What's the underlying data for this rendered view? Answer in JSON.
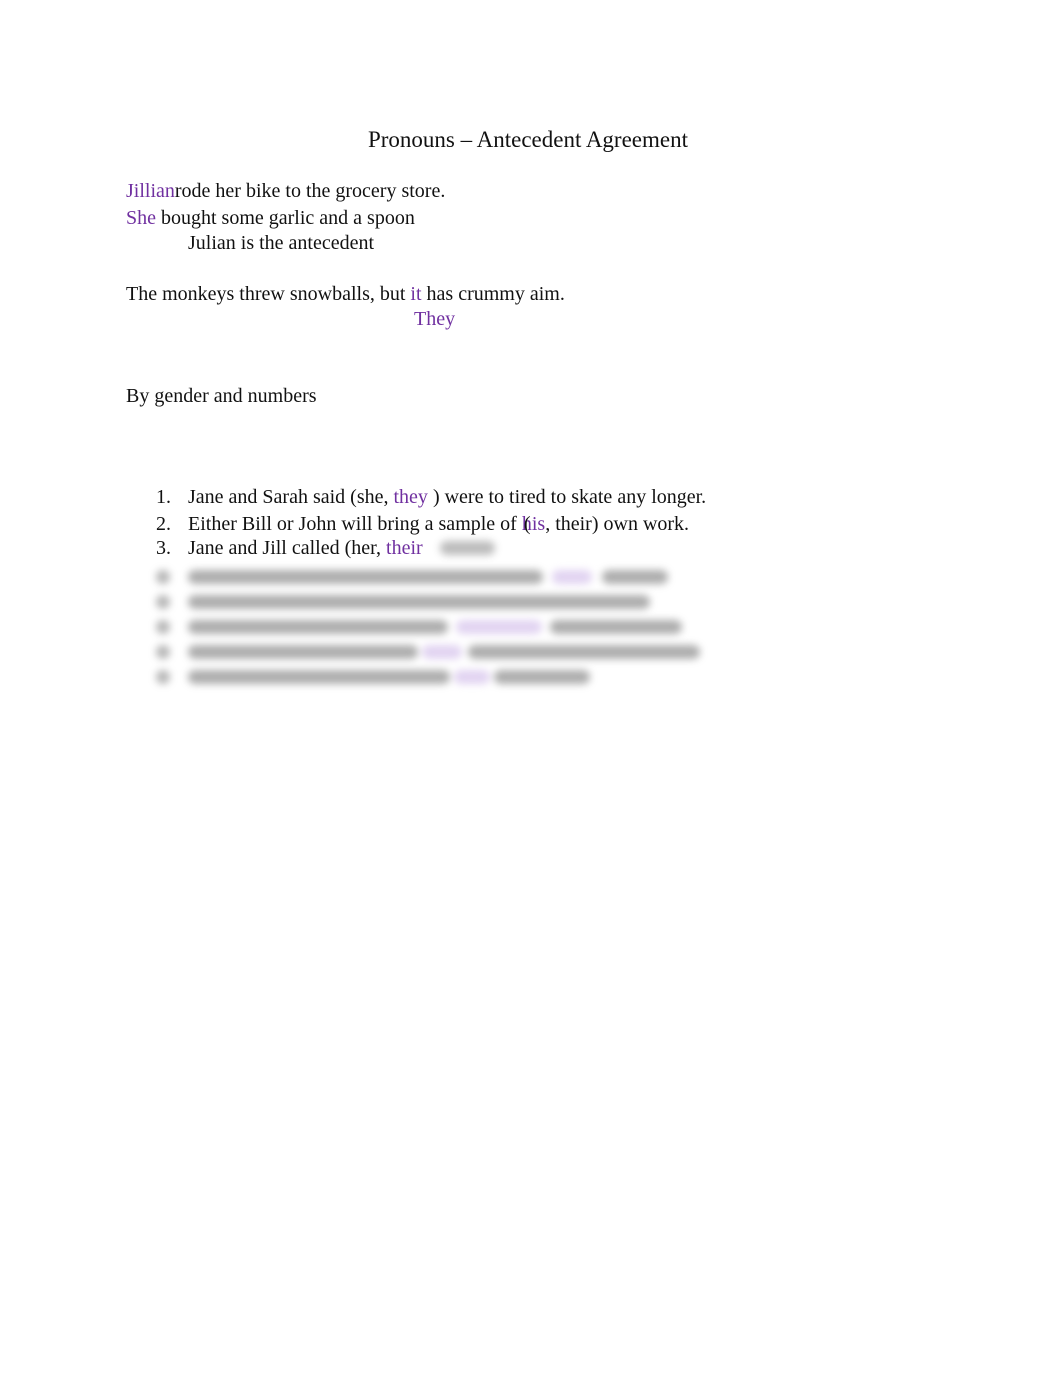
{
  "document": {
    "title": "Pronouns – Antecedent Agreement",
    "accent_color": "#7030a0",
    "example1": {
      "line1_highlight": "Jillian",
      "line1_rest": "rode her bike to the grocery store.",
      "line2_highlight": "She",
      "line2_rest": " bought some garlic and a spoon",
      "note": "Julian is the antecedent"
    },
    "example2": {
      "before": "The monkeys threw snowballs, but ",
      "highlight": "it",
      "after": " has crummy aim.",
      "correction": "They"
    },
    "section_heading": "By gender and numbers",
    "exercises": [
      {
        "number": "1.",
        "before": "Jane and Sarah said (she, ",
        "answer": "they",
        "after": " ) were to tired to skate any longer."
      },
      {
        "number": "2.",
        "before": "Either Bill or John will bring a sample of ",
        "overlap_char": "(",
        "answer": "his",
        "after": ", their) own work."
      },
      {
        "number": "3.",
        "before": "Jane and Jill called (her, ",
        "answer": "their",
        "after": ""
      }
    ],
    "blurred_items_count": 5
  }
}
